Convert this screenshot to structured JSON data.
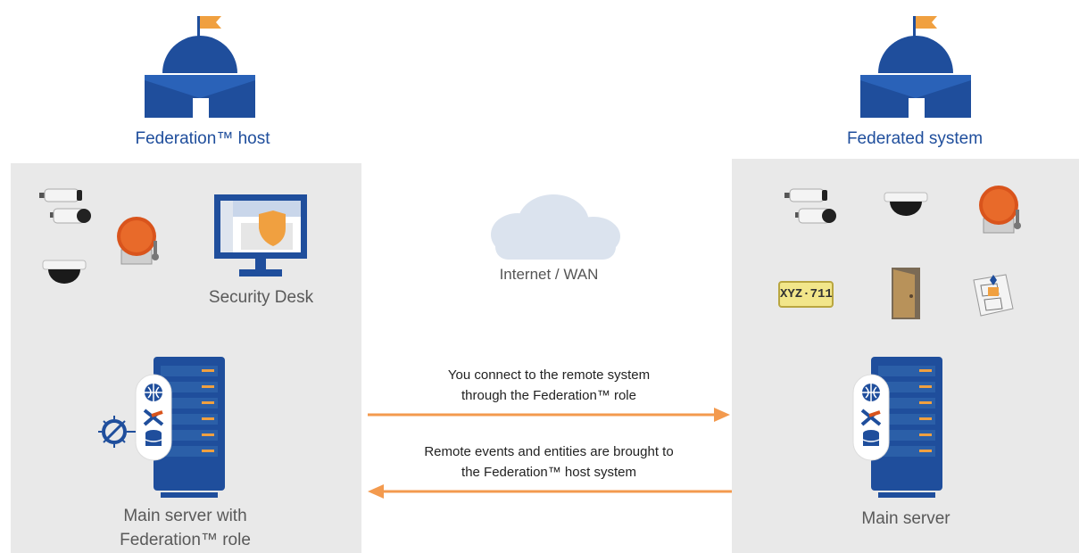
{
  "left": {
    "title": "Federation™ host",
    "workstation_label": "Security Desk",
    "server_label_line1": "Main server with",
    "server_label_line2": "Federation™ role"
  },
  "right": {
    "title": "Federated system",
    "plate_text": "XYZ·711",
    "server_label": "Main server"
  },
  "center": {
    "cloud_label": "Internet / WAN",
    "arrow1_line1": "You connect to the remote system",
    "arrow1_line2": "through the Federation™ role",
    "arrow2_line1": "Remote events and entities are brought to",
    "arrow2_line2": "the Federation™ host system"
  },
  "colors": {
    "brand_blue": "#1f4e9c",
    "accent_orange": "#f39a4e",
    "panel_gray": "#e9e9e9"
  }
}
